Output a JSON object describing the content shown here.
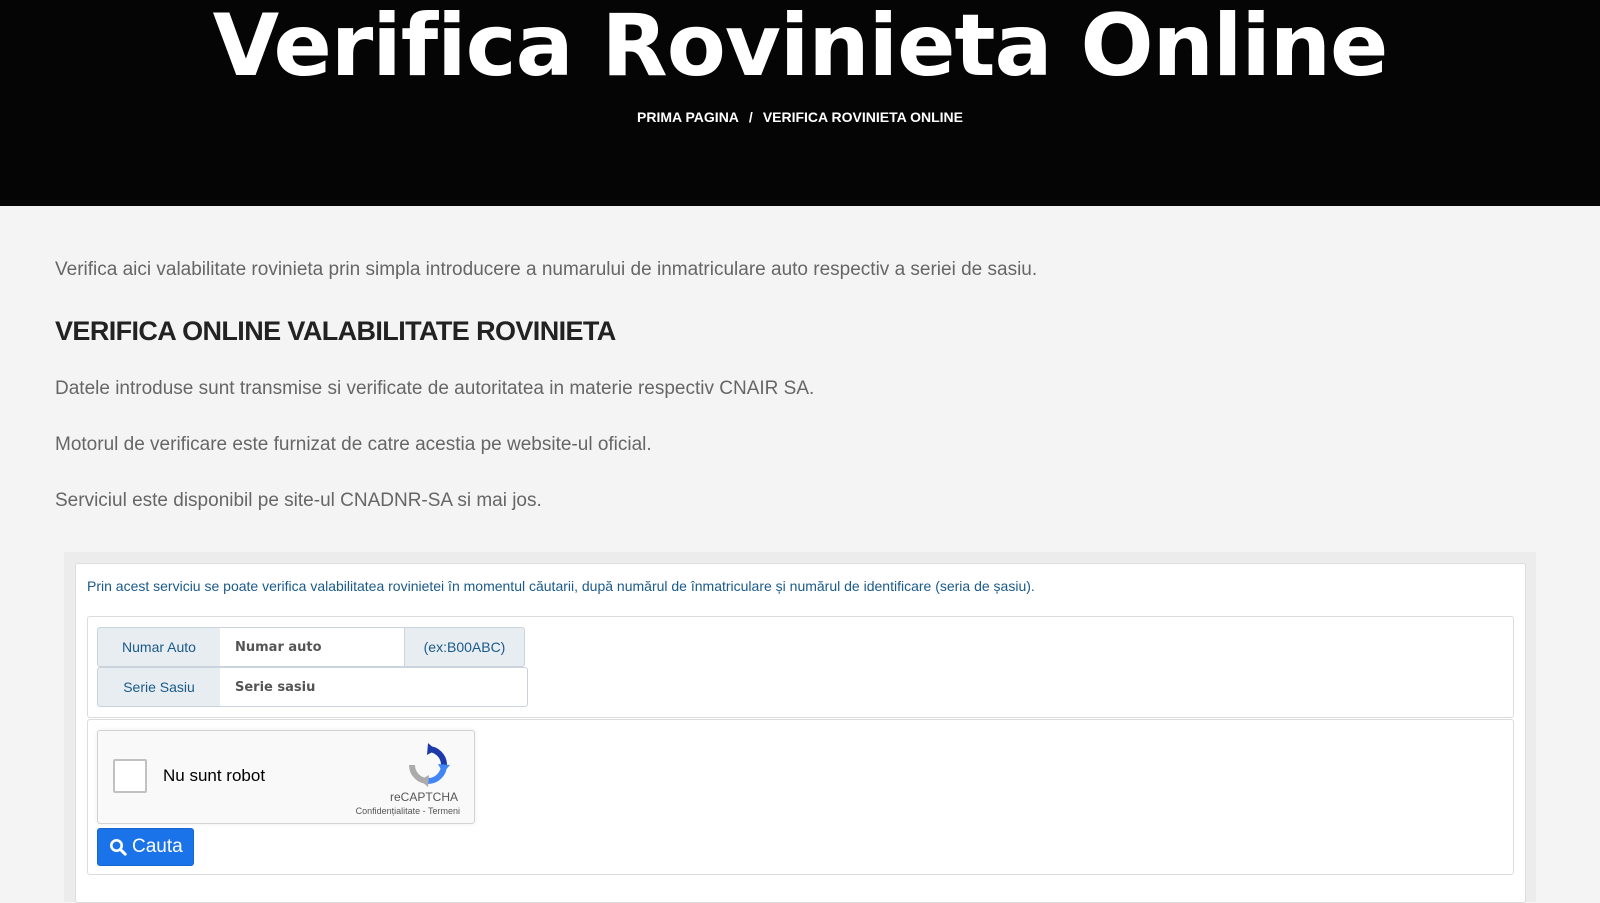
{
  "header": {
    "title": "Verifica Rovinieta Online",
    "breadcrumb": {
      "home": "PRIMA PAGINA",
      "separator": "/",
      "current": "VERIFICA ROVINIETA ONLINE"
    }
  },
  "content": {
    "intro": "Verifica aici valabilitate rovinieta prin simpla introducere a numarului de inmatriculare auto respectiv a seriei de sasiu.",
    "heading": "VERIFICA ONLINE VALABILITATE ROVINIETA",
    "paragraphs": [
      "Datele introduse sunt transmise si verificate de autoritatea in materie respectiv CNAIR SA.",
      "Motorul de verificare este furnizat de catre acestia pe website-ul oficial.",
      "Serviciul este disponibil pe site-ul CNADNR-SA si mai jos."
    ]
  },
  "form": {
    "note": "Prin acest serviciu se poate verifica valabilitatea rovinietei în momentul căutarii, după numărul de înmatriculare și numărul de identificare (seria de șasiu).",
    "numar_auto": {
      "label": "Numar Auto",
      "placeholder": "Numar auto",
      "value": "",
      "example": "(ex:B00ABC)"
    },
    "serie_sasiu": {
      "label": "Serie Sasiu",
      "placeholder": "Serie sasiu",
      "value": ""
    },
    "recaptcha": {
      "label": "Nu sunt robot",
      "brand": "reCAPTCHA",
      "links": "Confidențialitate - Termeni",
      "icon": "recaptcha-logo-icon"
    },
    "search_button": {
      "label": "Cauta",
      "icon": "search-icon"
    }
  },
  "colors": {
    "header_bg": "#050505",
    "page_bg": "#f4f4f4",
    "accent_blue": "#1a73e8",
    "form_text_blue": "#1a5a8a"
  }
}
